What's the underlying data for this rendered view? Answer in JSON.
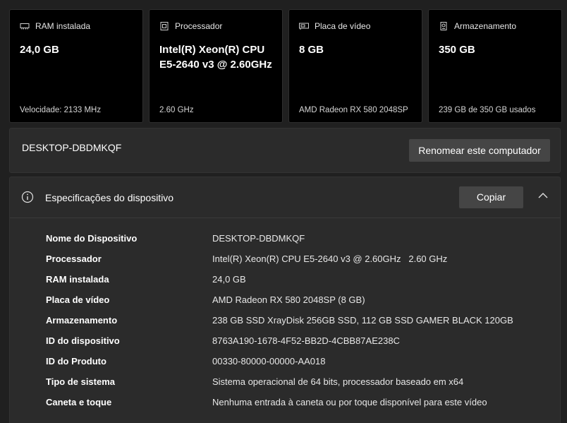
{
  "cards": [
    {
      "icon": "ram-icon",
      "title": "RAM instalada",
      "value": "24,0 GB",
      "footer": "Velocidade: 2133 MHz"
    },
    {
      "icon": "processor-icon",
      "title": "Processador",
      "value": "Intel(R) Xeon(R) CPU E5-2640 v3 @ 2.60GHz",
      "footer": "2.60 GHz"
    },
    {
      "icon": "graphics-card-icon",
      "title": "Placa de vídeo",
      "value": "8 GB",
      "footer": "AMD Radeon RX 580 2048SP"
    },
    {
      "icon": "storage-icon",
      "title": "Armazenamento",
      "value": "350 GB",
      "footer": "239 GB de 350 GB usados"
    }
  ],
  "device_bar": {
    "name": "DESKTOP-DBDMKQF",
    "rename_label": "Renomear este computador"
  },
  "specs": {
    "title": "Especificações do dispositivo",
    "copy_label": "Copiar",
    "rows": [
      {
        "label": "Nome do Dispositivo",
        "value": "DESKTOP-DBDMKQF"
      },
      {
        "label": "Processador",
        "value": "Intel(R) Xeon(R) CPU E5-2640 v3 @ 2.60GHz   2.60 GHz"
      },
      {
        "label": "RAM instalada",
        "value": "24,0 GB"
      },
      {
        "label": "Placa de vídeo",
        "value": "AMD Radeon RX 580 2048SP (8 GB)"
      },
      {
        "label": "Armazenamento",
        "value": "238 GB SSD XrayDisk 256GB SSD, 112 GB SSD GAMER BLACK 120GB"
      },
      {
        "label": "ID do dispositivo",
        "value": "8763A190-1678-4F52-BB2D-4CBB87AE238C"
      },
      {
        "label": "ID do Produto",
        "value": "00330-80000-00000-AA018"
      },
      {
        "label": "Tipo de sistema",
        "value": "Sistema operacional de 64 bits, processador baseado em x64"
      },
      {
        "label": "Caneta e toque",
        "value": "Nenhuma entrada à caneta ou por toque disponível para este vídeo"
      }
    ]
  },
  "colors": {
    "page_background": "#202020",
    "card_background": "#000000",
    "panel_background": "#2b2b2b",
    "button_background": "#454545",
    "text": "#ffffff"
  }
}
